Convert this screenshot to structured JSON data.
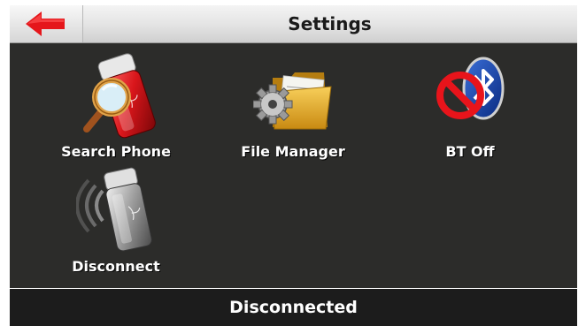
{
  "header": {
    "title": "Settings",
    "back_icon": "back-arrow-icon",
    "back_color": "#e5161b"
  },
  "tiles": [
    {
      "label": "Search Phone",
      "icon": "search-phone-icon"
    },
    {
      "label": "File Manager",
      "icon": "file-manager-icon"
    },
    {
      "label": "BT Off",
      "icon": "bluetooth-off-icon"
    },
    {
      "label": "Disconnect",
      "icon": "disconnect-phone-icon"
    }
  ],
  "status": {
    "text": "Disconnected"
  }
}
